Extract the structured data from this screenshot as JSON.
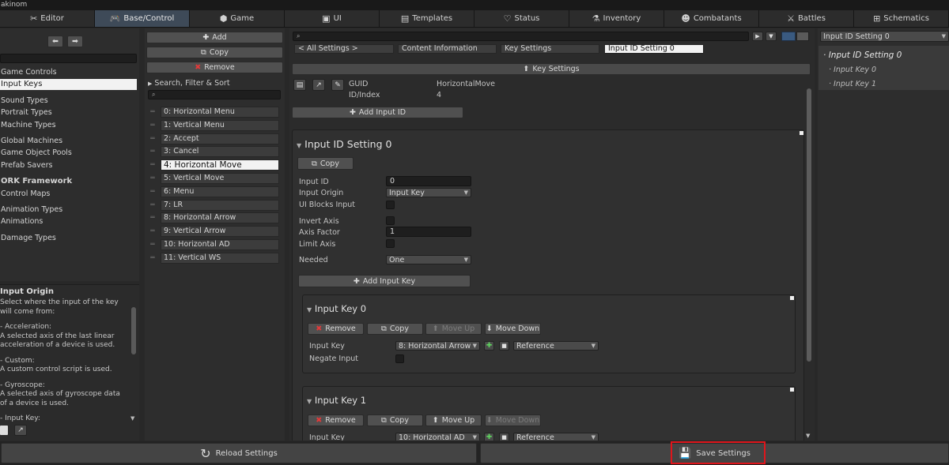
{
  "app": {
    "title": "akinom"
  },
  "tabs": [
    {
      "label": "Editor",
      "icon": "✂"
    },
    {
      "label": "Base/Control",
      "icon": "🎮"
    },
    {
      "label": "Game",
      "icon": "⬢"
    },
    {
      "label": "UI",
      "icon": "▣"
    },
    {
      "label": "Templates",
      "icon": "▤"
    },
    {
      "label": "Status",
      "icon": "♡"
    },
    {
      "label": "Inventory",
      "icon": "⚗"
    },
    {
      "label": "Combatants",
      "icon": "☻"
    },
    {
      "label": "Battles",
      "icon": "⚔"
    },
    {
      "label": "Schematics",
      "icon": "⊞"
    }
  ],
  "left_nav": {
    "items": [
      "Game Controls",
      "Input Keys",
      "Sound Types",
      "Portrait Types",
      "Machine Types",
      "Global Machines",
      "Game Object Pools",
      "Prefab Savers",
      "ORK Framework",
      "Control Maps",
      "Animation Types",
      "Animations",
      "Damage Types"
    ],
    "selected": "Input Keys"
  },
  "help": {
    "title": "Input Origin",
    "text1": "Select where the input of the key will come from:",
    "acc_title": "- Acceleration:",
    "acc_text": "A selected axis of the last linear acceleration of a device is used.",
    "custom_title": "- Custom:",
    "custom_text": "A custom control script is used.",
    "gyro_title": "- Gyroscope:",
    "gyro_text": "A selected axis of gyroscope data of a device is used.",
    "input_key": "- Input Key:"
  },
  "list_panel": {
    "add": "Add",
    "copy": "Copy",
    "remove": "Remove",
    "search_label": "Search, Filter & Sort",
    "items": [
      "0: Horizontal Menu",
      "1: Vertical Menu",
      "2: Accept",
      "3: Cancel",
      "4: Horizontal Move",
      "5: Vertical Move",
      "6: Menu",
      "7: LR",
      "8: Horizontal Arrow",
      "9: Vertical Arrow",
      "10: Horizontal AD",
      "11: Vertical WS"
    ],
    "selected_index": 4
  },
  "breadcrumbs": [
    "< All Settings >",
    "Content Information",
    "Key Settings",
    "Input ID Setting 0"
  ],
  "key_settings_header": "Key Settings",
  "info": {
    "guid_label": "GUID",
    "guid_value": "HorizontalMove",
    "id_label": "ID/Index",
    "id_value": "4"
  },
  "add_input_id": "Add Input ID",
  "setting": {
    "title": "Input ID Setting 0",
    "copy": "Copy",
    "input_id_label": "Input ID",
    "input_id_value": "0",
    "input_origin_label": "Input Origin",
    "input_origin_value": "Input Key",
    "ui_blocks_label": "UI Blocks Input",
    "invert_axis_label": "Invert Axis",
    "axis_factor_label": "Axis Factor",
    "axis_factor_value": "1",
    "limit_axis_label": "Limit Axis",
    "needed_label": "Needed",
    "needed_value": "One",
    "add_input_key": "Add Input Key"
  },
  "key0": {
    "title": "Input Key 0",
    "remove": "Remove",
    "copy": "Copy",
    "move_up": "Move Up",
    "move_down": "Move Down",
    "input_key_label": "Input Key",
    "input_key_value": "8: Horizontal Arrow",
    "reference": "Reference",
    "negate_label": "Negate Input"
  },
  "key1": {
    "title": "Input Key 1",
    "remove": "Remove",
    "copy": "Copy",
    "move_up": "Move Up",
    "move_down": "Move Down",
    "input_key_label": "Input Key",
    "input_key_value": "10: Horizontal AD",
    "reference": "Reference"
  },
  "tree": {
    "dropdown": "Input ID Setting 0",
    "root": "Input ID Setting 0",
    "children": [
      "Input Key 0",
      "Input Key 1"
    ]
  },
  "footer": {
    "reload": "Reload Settings",
    "save": "Save Settings"
  },
  "colors": {
    "highlight": "#e0151b",
    "accent": "#3e4a58"
  }
}
